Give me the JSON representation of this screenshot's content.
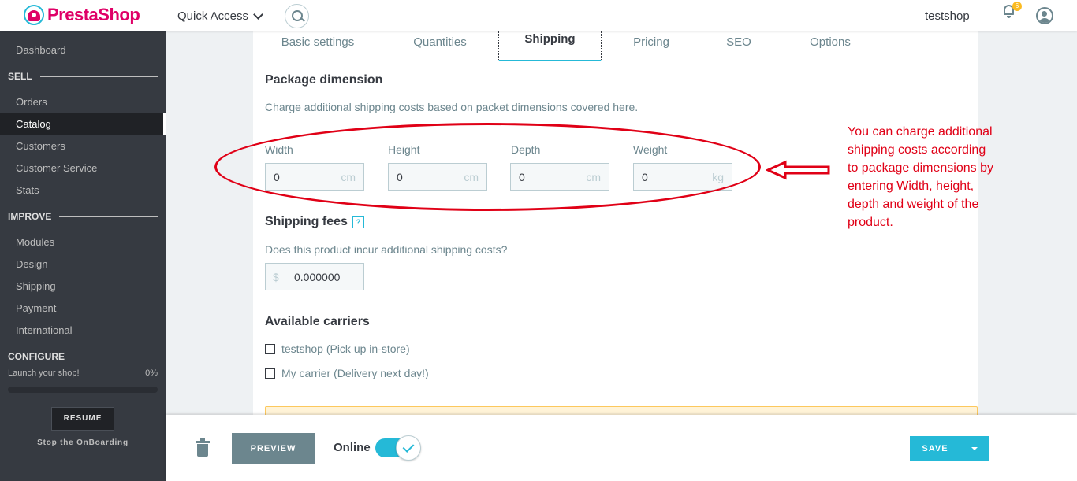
{
  "header": {
    "logo_text": "PrestaShop",
    "quick_access": "Quick Access",
    "shop_name": "testshop",
    "notification_count": "6"
  },
  "sidebar": {
    "dashboard": "Dashboard",
    "sections": {
      "sell": "SELL",
      "improve": "IMPROVE",
      "configure": "CONFIGURE"
    },
    "sell_items": [
      "Orders",
      "Catalog",
      "Customers",
      "Customer Service",
      "Stats"
    ],
    "improve_items": [
      "Modules",
      "Design",
      "Shipping",
      "Payment",
      "International"
    ],
    "active_item": "Catalog",
    "launch_text": "Launch your shop!",
    "launch_percent": "0%",
    "progress_fraction": 0,
    "resume_label": "RESUME",
    "stop_onboarding": "Stop the OnBoarding"
  },
  "tabs": [
    "Basic settings",
    "Quantities",
    "Shipping",
    "Pricing",
    "SEO",
    "Options"
  ],
  "active_tab": "Shipping",
  "package": {
    "title": "Package dimension",
    "description": "Charge additional shipping costs based on packet dimensions covered here.",
    "fields": [
      {
        "label": "Width",
        "value": "0",
        "unit": "cm"
      },
      {
        "label": "Height",
        "value": "0",
        "unit": "cm"
      },
      {
        "label": "Depth",
        "value": "0",
        "unit": "cm"
      },
      {
        "label": "Weight",
        "value": "0",
        "unit": "kg"
      }
    ]
  },
  "shipping_fees": {
    "title": "Shipping fees",
    "help": "?",
    "question": "Does this product incur additional shipping costs?",
    "currency": "$",
    "value": "0.000000"
  },
  "carriers": {
    "title": "Available carriers",
    "items": [
      {
        "label": "testshop (Pick up in-store)",
        "checked": false
      },
      {
        "label": "My carrier (Delivery next day!)",
        "checked": false
      }
    ]
  },
  "annotation": {
    "text": "You can charge additional shipping costs according to package dimensions by entering Width, height, depth and weight of the product.",
    "color": "#e00016"
  },
  "footer": {
    "preview": "PREVIEW",
    "online": "Online",
    "online_enabled": true,
    "save": "SAVE"
  },
  "colors": {
    "accent": "#25b9d7",
    "sidebar_bg": "#363a41",
    "brand": "#df0067"
  }
}
